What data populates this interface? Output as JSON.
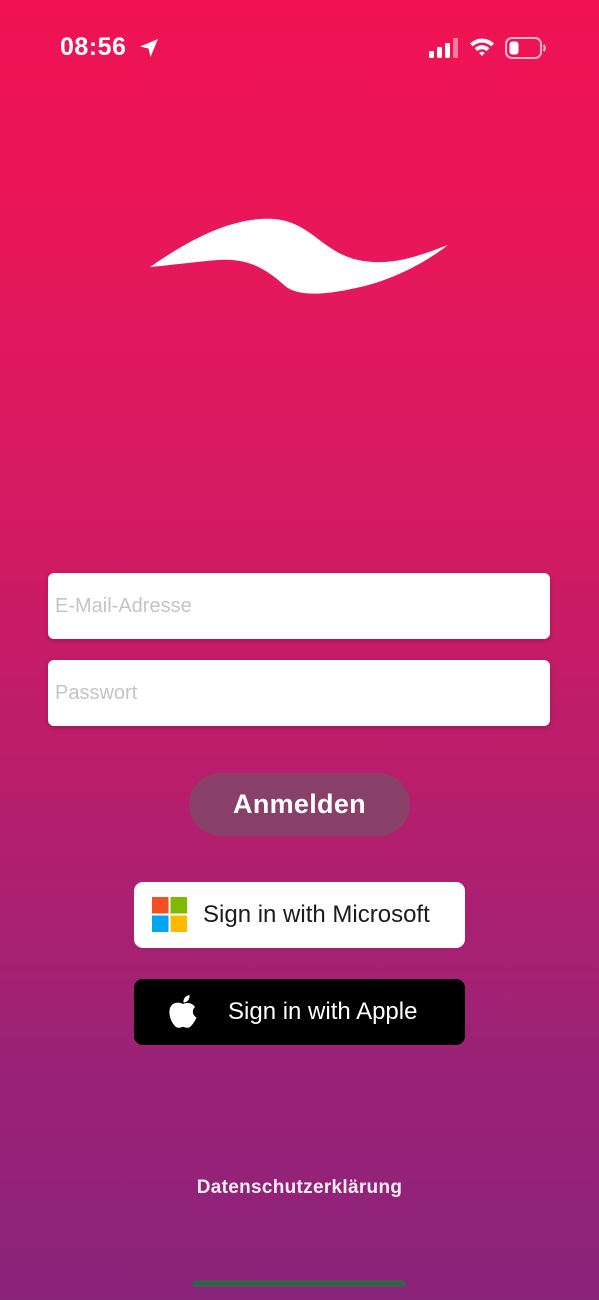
{
  "status_bar": {
    "time": "08:56",
    "icons": [
      "location-arrow-icon",
      "cellular-signal-icon",
      "wifi-icon",
      "battery-low-icon"
    ]
  },
  "logo": {
    "icon": "wave-logo-icon",
    "color": "#ffffff"
  },
  "form": {
    "email": {
      "value": "",
      "placeholder": "E-Mail-Adresse"
    },
    "password": {
      "value": "",
      "placeholder": "Passwort"
    },
    "login_label": "Anmelden"
  },
  "sso": {
    "microsoft_label": "Sign in with Microsoft",
    "microsoft_icon": "microsoft-logo-icon",
    "apple_label": "Sign in with Apple",
    "apple_icon": "apple-logo-icon"
  },
  "footer": {
    "privacy_label": "Datenschutzerklärung"
  },
  "colors": {
    "gradient_top": "#f01252",
    "gradient_bottom": "#8a237a",
    "login_button": "#7c4a66",
    "apple_button": "#000000",
    "microsoft_button": "#ffffff",
    "ms_red": "#f25022",
    "ms_green": "#7fba00",
    "ms_blue": "#00a4ef",
    "ms_yellow": "#ffb900"
  }
}
